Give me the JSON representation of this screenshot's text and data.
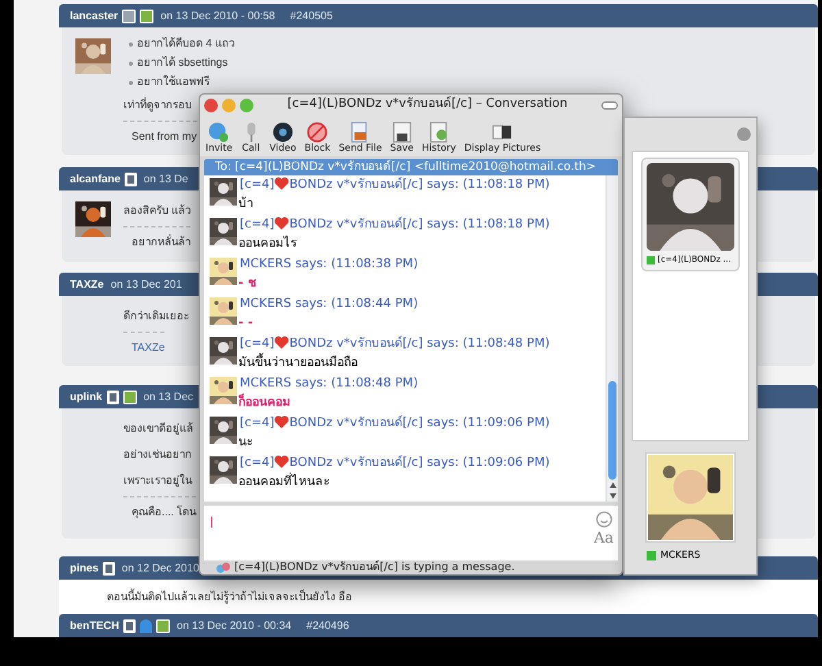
{
  "forum": {
    "posts": [
      {
        "user": "lancaster",
        "date": "on 13 Dec 2010 - 00:58",
        "post_id": "#240505",
        "body": [
          {
            "kind": "bullet",
            "text": "อยากได้คีบอด 4 แถว"
          },
          {
            "kind": "bullet",
            "text": "อยากได้ sbsettings"
          },
          {
            "kind": "bullet",
            "text": "อยากใช้แอพฟรี"
          },
          {
            "kind": "text",
            "text": "เท่าที่ดูจากรอบ"
          },
          {
            "kind": "signature",
            "text": "Sent from my"
          }
        ]
      },
      {
        "user": "alcanfane",
        "date": "on 13 De",
        "body": [
          {
            "kind": "text",
            "text": "ลองสิครับ แล้ว"
          },
          {
            "kind": "signature",
            "text": "อยากหลั่นล้า"
          }
        ]
      },
      {
        "user": "TAXZe",
        "date": "on 13 Dec 201",
        "body": [
          {
            "kind": "text",
            "text": "ดีกว่าเดิมเยอะ"
          },
          {
            "kind": "link",
            "text": "TAXZe"
          }
        ]
      },
      {
        "user": "uplink",
        "date": "on 13 Dec",
        "body": [
          {
            "kind": "text",
            "text": "ของเขาดีอยู่แล้"
          },
          {
            "kind": "text",
            "text": "อย่างเช่นอยาก"
          },
          {
            "kind": "text",
            "text": "เพราะเราอยู่ใน"
          },
          {
            "kind": "signature",
            "text": "คุณคือ.... โดน"
          }
        ]
      },
      {
        "user": "pines",
        "date": "on 12 Dec 2010",
        "body": [
          {
            "kind": "plain",
            "text": "ตอนนี้มันติดไปแล้วเลยไม่รู้ว่าถ้าไม่เจลจะเป็นยังไง อือ"
          }
        ]
      },
      {
        "user": "benTECH",
        "date": "on 13 Dec 2010 - 00:34",
        "post_id": "#240496"
      }
    ]
  },
  "window": {
    "title": "[c=4](L)BONDz v*vรักบอนด์[/c] – Conversation",
    "toolbar": [
      {
        "kind": "invite",
        "label": "Invite"
      },
      {
        "kind": "call",
        "label": "Call"
      },
      {
        "kind": "video",
        "label": "Video"
      },
      {
        "kind": "block",
        "label": "Block"
      },
      {
        "kind": "file",
        "label": "Send File"
      },
      {
        "kind": "save",
        "label": "Save"
      },
      {
        "kind": "history",
        "label": "History"
      },
      {
        "kind": "pictures",
        "label": "Display Pictures"
      }
    ],
    "to": "To: [c=4](L)BONDz v*vรักบอนด์[/c] <fulltime2010@hotmail.co.th>",
    "messages": [
      {
        "kind": "contact",
        "prefix": "[c=4]",
        "heart": true,
        "sender": "BONDz v*vรักบอนด์[/c] says: (11:08:18 PM)",
        "text": "บ้า"
      },
      {
        "kind": "contact",
        "prefix": "[c=4]",
        "heart": true,
        "sender": "BONDz v*vรักบอนด์[/c] says: (11:08:18 PM)",
        "text": "ออนคอมไร"
      },
      {
        "kind": "self",
        "heart": false,
        "sender": "MCKERS says: (11:08:38 PM)",
        "text": "- ช"
      },
      {
        "kind": "self",
        "heart": false,
        "sender": "MCKERS says: (11:08:44 PM)",
        "text": "- -"
      },
      {
        "kind": "contact",
        "prefix": "[c=4]",
        "heart": true,
        "sender": "BONDz v*vรักบอนด์[/c] says: (11:08:48 PM)",
        "text": "มันขึ้นว่านายออนมือถือ"
      },
      {
        "kind": "self",
        "heart": false,
        "sender": "MCKERS says: (11:08:48 PM)",
        "text": "ก็ออนคอม"
      },
      {
        "kind": "contact",
        "prefix": "[c=4]",
        "heart": true,
        "sender": "BONDz v*vรักบอนด์[/c] says: (11:09:06 PM)",
        "text": "นะ"
      },
      {
        "kind": "contact",
        "prefix": "[c=4]",
        "heart": true,
        "sender": "BONDz v*vรักบอนด์[/c] says: (11:09:06 PM)",
        "text": "ออนคอมที่ไหนละ"
      }
    ],
    "font_button": "Aa",
    "status": "[c=4](L)BONDz v*vรักบอนด์[/c] is typing a message."
  },
  "pictures_panel": {
    "contact": {
      "name": "[c=4](L)BONDz ..."
    },
    "self": {
      "name": "MCKERS"
    }
  }
}
